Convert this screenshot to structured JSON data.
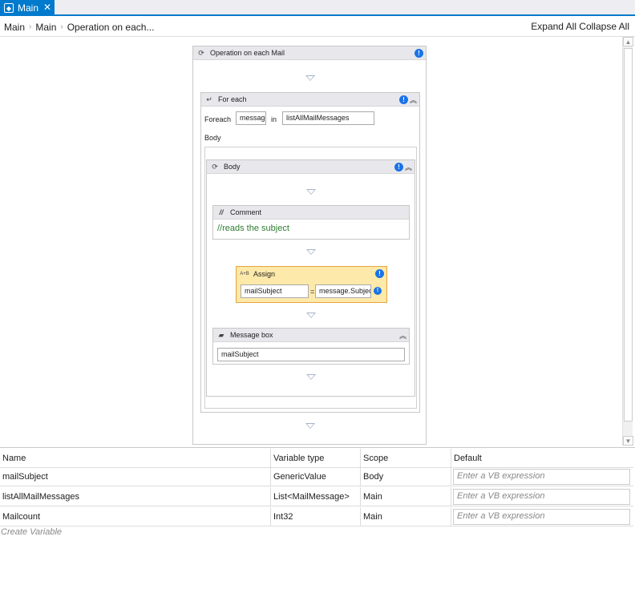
{
  "tab": {
    "label": "Main",
    "close": "✕"
  },
  "breadcrumb": [
    "Main",
    "Main",
    "Operation on each..."
  ],
  "toolbar": {
    "expand_all": "Expand All",
    "collapse_all": "Collapse All"
  },
  "sequence": {
    "title": "Operation on each Mail"
  },
  "foreach": {
    "title": "For each",
    "foreach_label": "Foreach",
    "item_value": "message",
    "in_label": "in",
    "collection_value": "listAllMailMessages",
    "body_label": "Body"
  },
  "body": {
    "title": "Body"
  },
  "comment": {
    "title": "Comment",
    "text": "//reads the subject"
  },
  "assign": {
    "title": "Assign",
    "left": "mailSubject",
    "equals": "=",
    "right": "message.Subject"
  },
  "messagebox": {
    "title": "Message box",
    "value": "mailSubject"
  },
  "variables": {
    "headers": [
      "Name",
      "Variable type",
      "Scope",
      "Default"
    ],
    "rows": [
      {
        "name": "mailSubject",
        "type": "GenericValue",
        "scope": "Body",
        "default": "Enter a VB expression"
      },
      {
        "name": "listAllMailMessages",
        "type": "List<MailMessage>",
        "scope": "Main",
        "default": "Enter a VB expression"
      },
      {
        "name": "Mailcount",
        "type": "Int32",
        "scope": "Main",
        "default": "Enter a VB expression"
      }
    ],
    "create": "Create Variable"
  },
  "colors": {
    "accent": "#007acc",
    "assign_bg": "#fde9a9",
    "assign_border": "#e8a33c",
    "comment_text": "#2e7d32",
    "info": "#1a73e8"
  }
}
